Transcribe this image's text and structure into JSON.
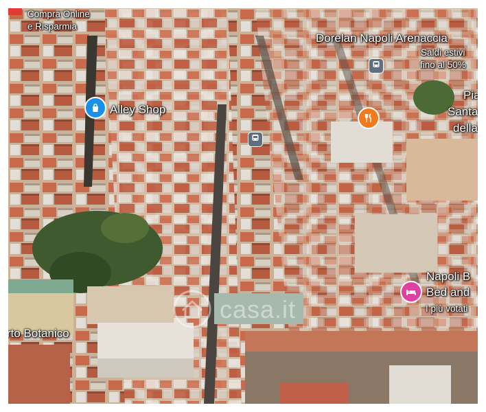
{
  "labels": {
    "compra_line1": "Compra Online",
    "compra_line2": "e Risparmia",
    "dorelan": "Dorelan Napoli Arenaccia",
    "saldi_line1": "Saldi estivi",
    "saldi_line2": "fino al 50%",
    "pia": "Pia",
    "santa": "Santa",
    "della": "della",
    "alley_shop": "Alley Shop",
    "napoli_b": "Napoli B",
    "bed_and": "Bed and",
    "piu_votati": "I più votati",
    "orto_botanico": "rto Botanico",
    "watermark": "casa.it"
  },
  "icons": {
    "shop_pin": "shopping-bag-icon",
    "restaurant_pin": "fork-knife-icon",
    "hotel_pin": "bed-icon",
    "transit": "bus-icon"
  },
  "colors": {
    "shop_pin": "#1a8fe8",
    "restaurant_pin": "#f07a1c",
    "hotel_pin": "#e040a0",
    "transit": "#5f6f80"
  }
}
